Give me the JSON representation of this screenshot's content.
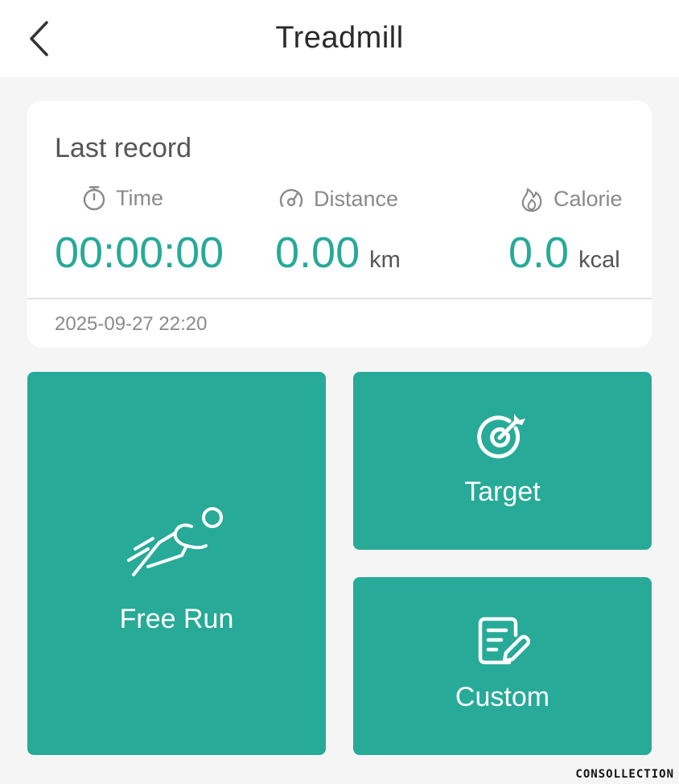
{
  "header": {
    "title": "Treadmill"
  },
  "last_record": {
    "title": "Last record",
    "time": {
      "label": "Time",
      "value": "00:00:00",
      "icon": "stopwatch-icon"
    },
    "distance": {
      "label": "Distance",
      "value": "0.00",
      "unit": "km",
      "icon": "speedometer-icon"
    },
    "calorie": {
      "label": "Calorie",
      "value": "0.0",
      "unit": "kcal",
      "icon": "flame-icon"
    },
    "date": "2025-09-27 22:20"
  },
  "modes": {
    "free_run": {
      "label": "Free Run",
      "icon": "runner-icon"
    },
    "target": {
      "label": "Target",
      "icon": "target-icon"
    },
    "custom": {
      "label": "Custom",
      "icon": "edit-document-icon"
    }
  },
  "watermark": "CONSOLLECTION",
  "colors": {
    "accent": "#27aa98",
    "background": "#f5f5f5",
    "card": "#ffffff",
    "text_dark": "#2a2a2a",
    "text_muted": "#8a8a8a"
  }
}
